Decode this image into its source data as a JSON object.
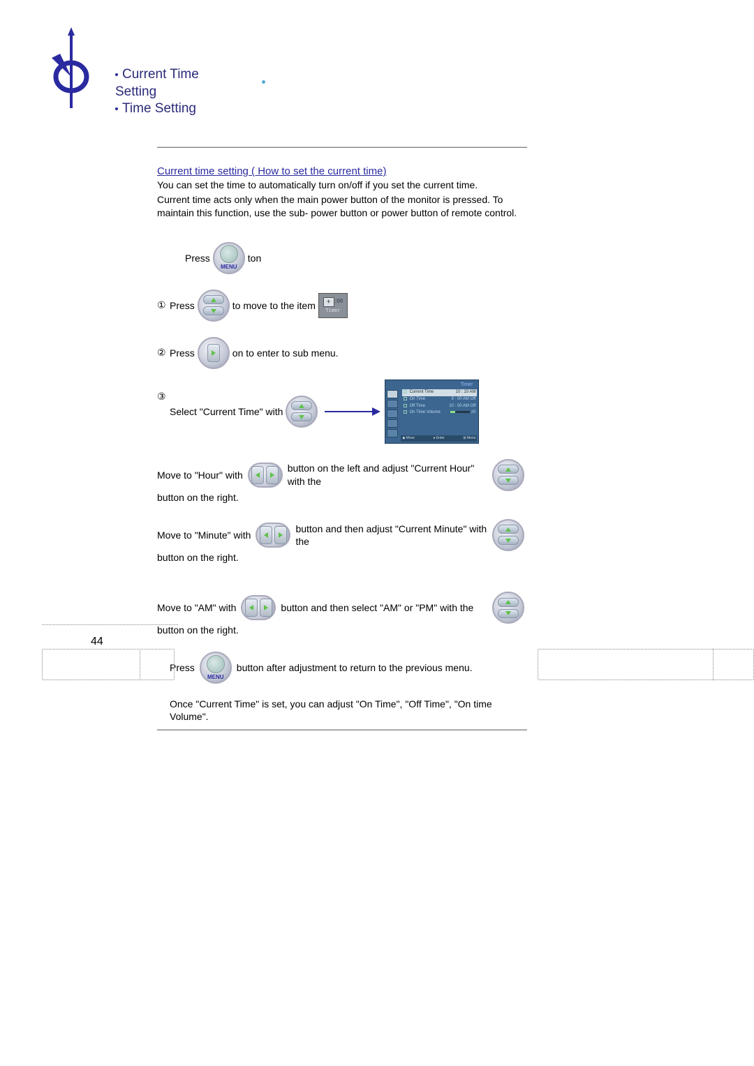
{
  "header": {
    "line1": "Current Time Setting",
    "line2": "Time Setting"
  },
  "heading": "Current time setting ( How to set the current time)",
  "intro1": "You can set the time to automatically turn on/off if you set the current time.",
  "intro2": "Current time acts only when the main power button of the monitor is pressed. To maintain this function, use the sub- power button or power button of remote control.",
  "steps": {
    "press_word": "Press",
    "ton": "ton",
    "step1_a": "Press",
    "step1_b": "to move to the item",
    "step2_a": "Press",
    "step2_b": "on to enter to sub menu.",
    "step3_a": "Select \"Current Time\" with",
    "num1": "①",
    "num2": "②",
    "num3": "③"
  },
  "hour_a": "Move to \"Hour\" with",
  "hour_b": "button on the left and adjust \"Current Hour\" with the",
  "hour_c": "button on the right.",
  "minute_a": "Move to \"Minute\" with",
  "minute_b": "button and then adjust \"Current Minute\" with the",
  "minute_c": "button on the right.",
  "ampm_a": "Move to \"AM\" with",
  "ampm_b": "button and then select \"AM\" or \"PM\" with the",
  "ampm_c": "button on the right.",
  "return_a": "Press",
  "return_b": "button after adjustment to return to the previous menu.",
  "note": "Once \"Current Time\" is set, you can adjust \"On Time\", \"Off Time\", \"On time Volume\".",
  "menu_label": "MENU",
  "timer_label": "Timer",
  "timer_zeros": ":00",
  "osd": {
    "title": "Timer",
    "r1_left": "Current Time",
    "r1_right": "10 : 10   AM",
    "r2_left": "On Time",
    "r2_right": "9 : 00   AM   Off",
    "r3_left": "Off Time",
    "r3_right": "10 : 00   AM   Off",
    "r4_left": "On Time Volume",
    "r4_right": "20",
    "f1": "◆ Move",
    "f2": "● Enter",
    "f3": "⊞ Menu"
  },
  "page_number": "44"
}
